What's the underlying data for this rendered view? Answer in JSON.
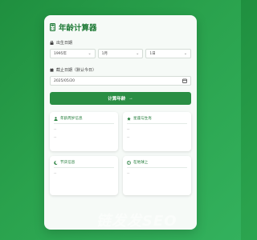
{
  "header": {
    "title": "年龄计算器",
    "icon": "calculator-icon"
  },
  "birth": {
    "label": "出生日期",
    "year": "1995年",
    "month": "1月",
    "day": "1日"
  },
  "end_date": {
    "label": "截止日期（默认今日）",
    "value": "2025/05/20"
  },
  "calculate_button": {
    "label": "计算年龄",
    "arrow": "→"
  },
  "results": [
    {
      "title": "年龄周岁信息",
      "icon": "user-icon",
      "lines": [
        "--",
        "--"
      ]
    },
    {
      "title": "星座与生肖",
      "icon": "star-icon",
      "lines": [
        "--",
        "--"
      ]
    },
    {
      "title": "节庆信息",
      "icon": "moon-icon",
      "lines": [
        "--"
      ]
    },
    {
      "title": "在地球上",
      "icon": "globe-icon",
      "lines": [
        "--"
      ]
    }
  ],
  "watermark": "链发发SEO",
  "colors": {
    "accent": "#2a8e44",
    "background": "#2aa24d",
    "title": "#1e7a36"
  }
}
